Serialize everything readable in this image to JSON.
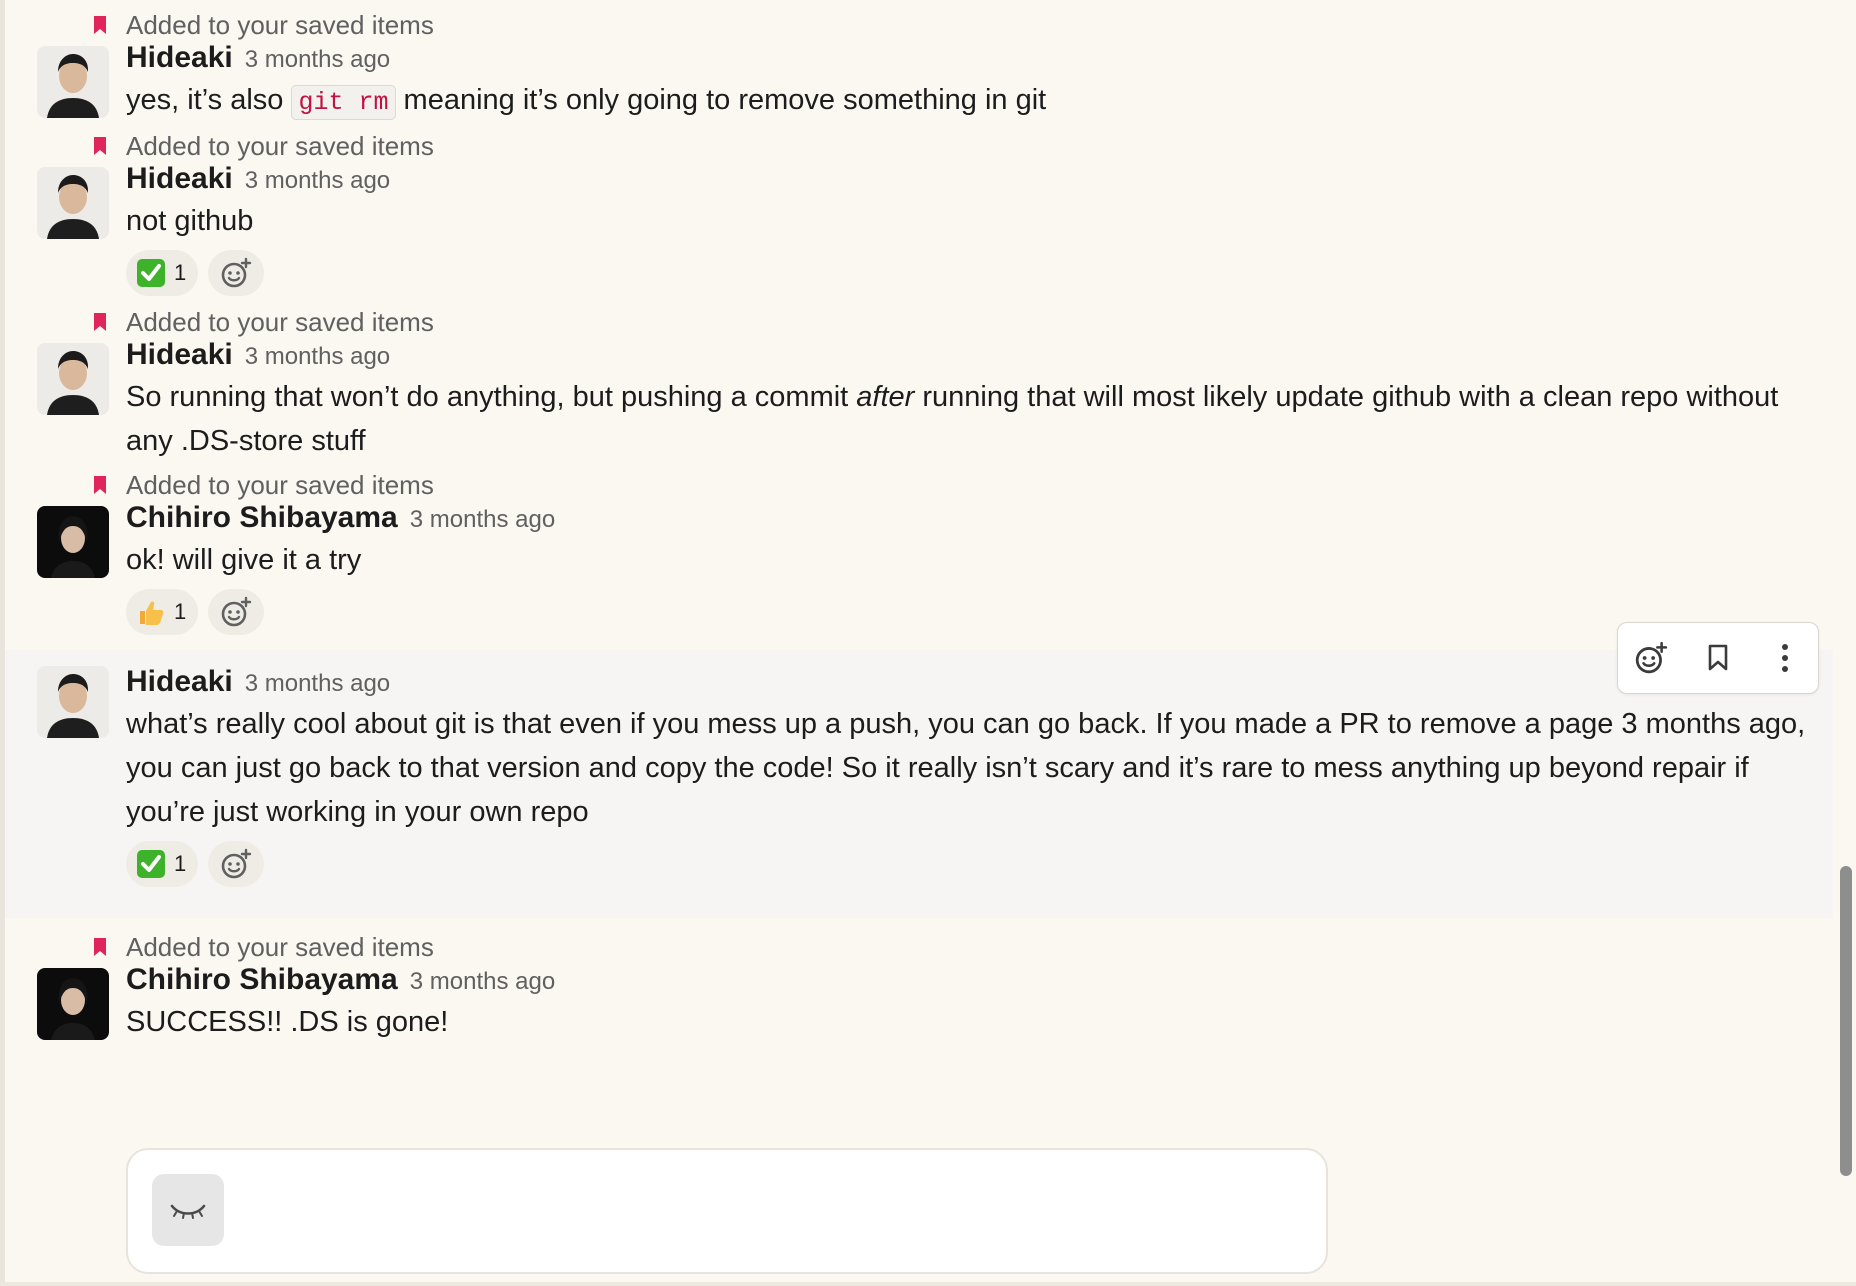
{
  "saved_label": "Added to your saved items",
  "colors": {
    "bookmark": "#e0255d",
    "code_text": "#c01343",
    "background": "#fbf8f1",
    "hover_row": "#f6f5f3"
  },
  "messages": [
    {
      "saved": true,
      "author": "Hideaki",
      "time": "3 months ago",
      "avatar": "hideaki-avatar",
      "parts": {
        "pre": "yes, it’s also ",
        "code": "git rm",
        "post": " meaning it’s only going to remove something in git"
      },
      "reactions": []
    },
    {
      "saved": true,
      "author": "Hideaki",
      "time": "3 months ago",
      "avatar": "hideaki-avatar",
      "text": "not github",
      "reactions": [
        {
          "emoji": "white-check-mark",
          "count": "1"
        }
      ]
    },
    {
      "saved": true,
      "author": "Hideaki",
      "time": "3 months ago",
      "avatar": "hideaki-avatar",
      "parts": {
        "pre": "So running that won’t do anything, but pushing a commit ",
        "em": "after",
        "post": " running that will most likely update github with a clean repo without any .DS-store stuff"
      },
      "reactions": []
    },
    {
      "saved": true,
      "author": "Chihiro Shibayama",
      "time": "3 months ago",
      "avatar": "chihiro-avatar",
      "text": "ok! will give it a try",
      "reactions": [
        {
          "emoji": "thumbs-up",
          "count": "1"
        }
      ]
    },
    {
      "saved": false,
      "hovered": true,
      "author": "Hideaki",
      "time": "3 months ago",
      "avatar": "hideaki-avatar",
      "text": "what’s really cool about git is that even if you mess up a push, you can go back. If you made a PR to remove a page 3 months ago, you can just go back to that version and copy the code! So it really isn’t scary and it’s rare to mess anything up beyond repair if you’re just working in your own repo",
      "reactions": [
        {
          "emoji": "white-check-mark",
          "count": "1"
        }
      ]
    },
    {
      "saved": true,
      "author": "Chihiro Shibayama",
      "time": "3 months ago",
      "avatar": "chihiro-avatar",
      "text": "SUCCESS!! .DS is gone!",
      "reactions": []
    }
  ],
  "hover_toolbar": [
    "add-reaction-icon",
    "bookmark-icon",
    "more-actions-icon"
  ],
  "composer": {
    "icon": "sleeping-face-icon"
  }
}
